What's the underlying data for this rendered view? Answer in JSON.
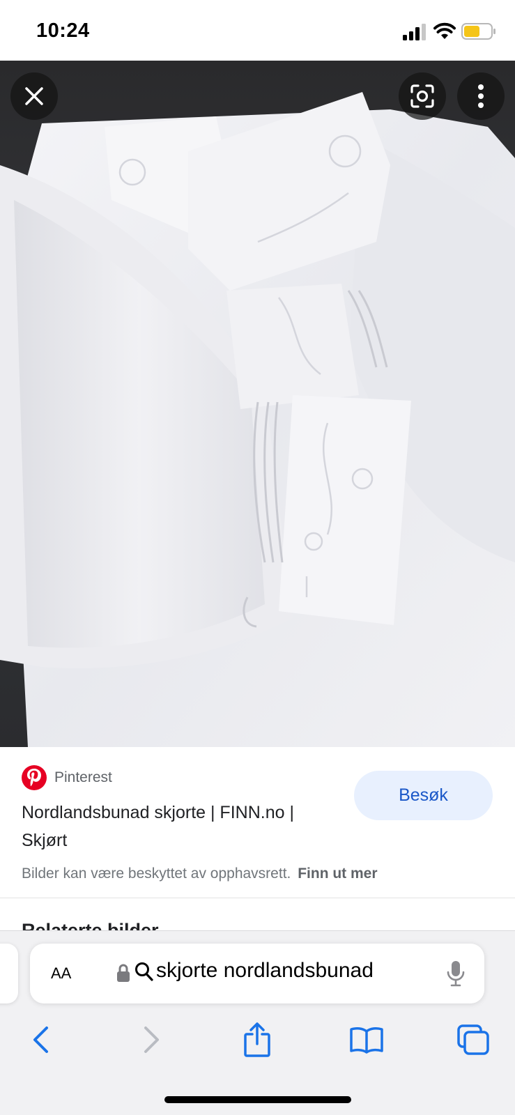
{
  "status_bar": {
    "time": "10:24",
    "icons": [
      "signal-icon",
      "wifi-icon",
      "battery-icon"
    ],
    "battery_color": "#f5c518"
  },
  "viewer": {
    "image_description_icon": "embroidered-shirt-photo",
    "buttons": [
      "close-icon",
      "lens-icon",
      "more-vertical-icon"
    ]
  },
  "result": {
    "source": "Pinterest",
    "source_icon": "pinterest-logo",
    "title": "Nordlandsbunad skjorte | FINN.no | Skjørt",
    "visit_label": "Besøk",
    "copyright_text": "Bilder kan være beskyttet av opphavsrett.",
    "learn_more_label": "Finn ut mer",
    "related_heading": "Relaterte bilder"
  },
  "safari": {
    "text_size_label": "AA",
    "url_text": "skjorte nordlandsbunad",
    "icons": [
      "lock-icon",
      "search-icon",
      "microphone-icon",
      "back-icon",
      "forward-icon",
      "share-icon",
      "bookmarks-icon",
      "tabs-icon"
    ],
    "accent_color": "#1a73e8"
  }
}
